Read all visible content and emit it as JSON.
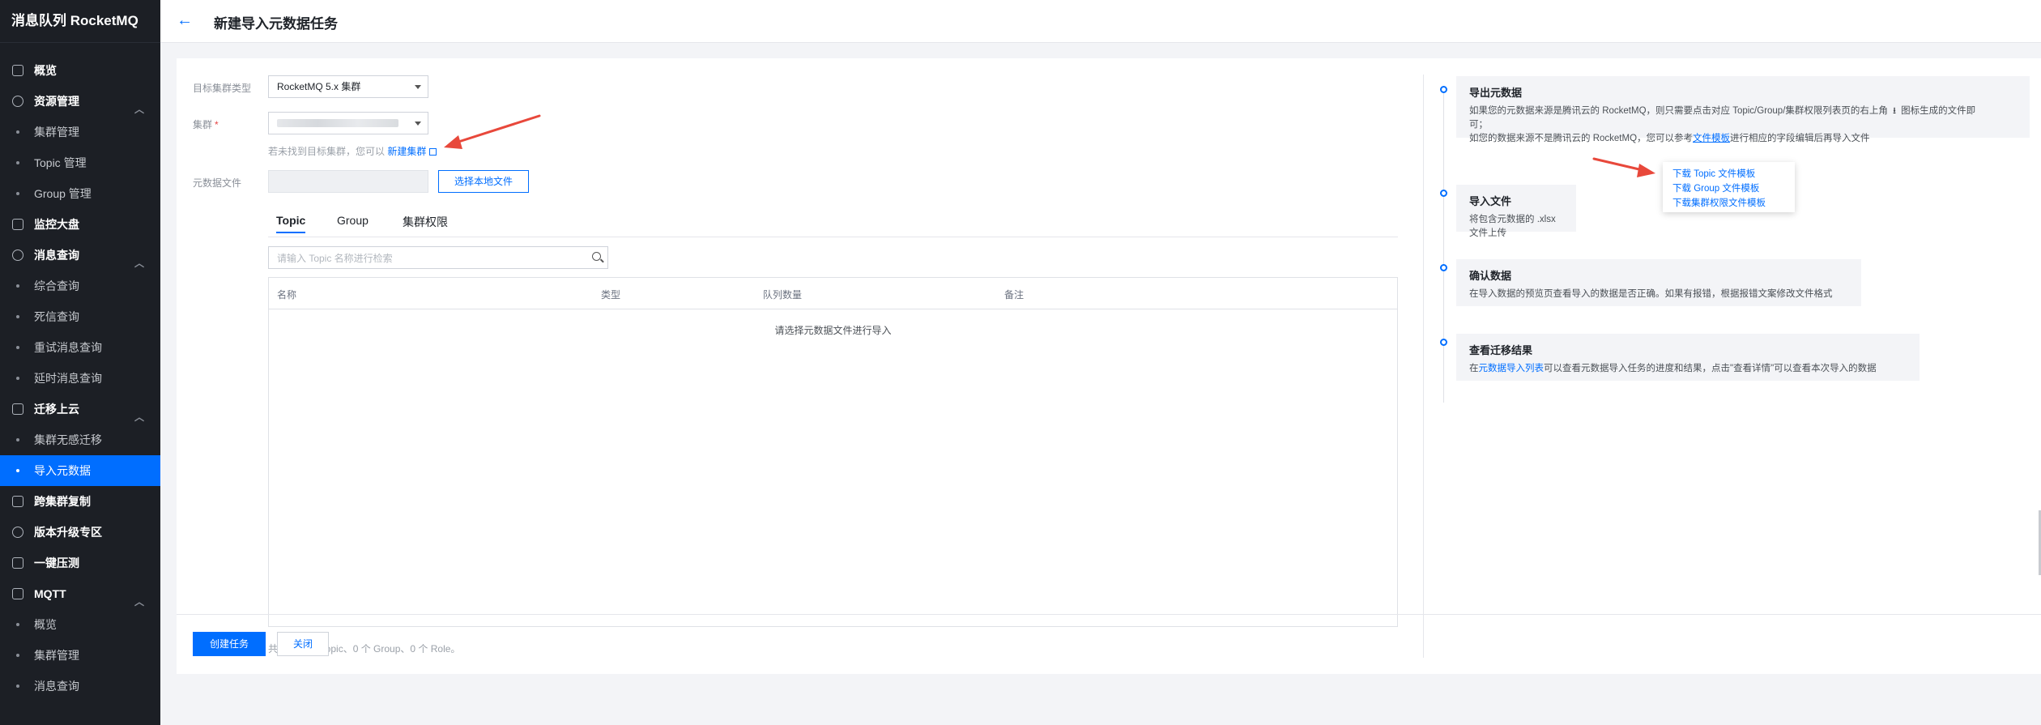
{
  "app": {
    "brand": "消息队列 RocketMQ"
  },
  "header": {
    "title": "新建导入元数据任务"
  },
  "sidebar": {
    "items": [
      {
        "label": "概览",
        "kind": "section",
        "icon": "grid-icon"
      },
      {
        "label": "资源管理",
        "kind": "section",
        "icon": "globe-icon",
        "expandable": true
      },
      {
        "label": "集群管理",
        "kind": "sub"
      },
      {
        "label": "Topic 管理",
        "kind": "sub"
      },
      {
        "label": "Group 管理",
        "kind": "sub"
      },
      {
        "label": "监控大盘",
        "kind": "section",
        "icon": "dashboard-icon"
      },
      {
        "label": "消息查询",
        "kind": "section",
        "icon": "at-icon",
        "expandable": true
      },
      {
        "label": "综合查询",
        "kind": "sub"
      },
      {
        "label": "死信查询",
        "kind": "sub"
      },
      {
        "label": "重试消息查询",
        "kind": "sub"
      },
      {
        "label": "延时消息查询",
        "kind": "sub"
      },
      {
        "label": "迁移上云",
        "kind": "section",
        "icon": "migrate-icon",
        "expandable": true
      },
      {
        "label": "集群无感迁移",
        "kind": "sub"
      },
      {
        "label": "导入元数据",
        "kind": "sub",
        "active": true
      },
      {
        "label": "跨集群复制",
        "kind": "section",
        "icon": "copy-icon"
      },
      {
        "label": "版本升级专区",
        "kind": "section",
        "icon": "shield-icon"
      },
      {
        "label": "一键压测",
        "kind": "section",
        "icon": "chart-icon"
      },
      {
        "label": "MQTT",
        "kind": "section",
        "icon": "mqtt-icon",
        "expandable": true
      },
      {
        "label": "概览",
        "kind": "sub"
      },
      {
        "label": "集群管理",
        "kind": "sub"
      },
      {
        "label": "消息查询",
        "kind": "sub"
      }
    ]
  },
  "form": {
    "cluster_type_label": "目标集群类型",
    "cluster_type_value": "RocketMQ 5.x 集群",
    "cluster_label": "集群",
    "cluster_required_mark": "*",
    "hint_prefix": "若未找到目标集群，您可以",
    "hint_link": "新建集群",
    "file_label": "元数据文件",
    "file_button": "选择本地文件"
  },
  "tabs": [
    {
      "label": "Topic",
      "active": true
    },
    {
      "label": "Group",
      "active": false
    },
    {
      "label": "集群权限",
      "active": false
    }
  ],
  "search": {
    "placeholder": "请输入 Topic 名称进行检索"
  },
  "table": {
    "columns": [
      "名称",
      "类型",
      "队列数量",
      "备注"
    ],
    "empty_text": "请选择元数据文件进行导入"
  },
  "summary": "共导入 0 个 Topic、0 个 Group、0 个 Role。",
  "steps": [
    {
      "title": "导出元数据",
      "desc_line1_a": "如果您的元数据来源是腾讯云的 RocketMQ，则只需要点击对应 Topic/Group/集群权限列表页的右上角",
      "desc_line1_b": "图标生成的文件即",
      "desc_line2": "可；",
      "desc_line3_a": "如您的数据来源不是腾讯云的 RocketMQ，您可以参考",
      "desc_line3_link": "文件模板",
      "desc_line3_b": "进行相应的字段编辑后再导入文件"
    },
    {
      "title": "导入文件",
      "desc": "将包含元数据的 .xlsx 文件上传"
    },
    {
      "title": "确认数据",
      "desc": "在导入数据的预览页查看导入的数据是否正确。如果有报错，根据报错文案修改文件格式"
    },
    {
      "title": "查看迁移结果",
      "desc_a": "在",
      "desc_link": "元数据导入列表",
      "desc_b": "可以查看元数据导入任务的进度和结果，点击\"查看详情\"可以查看本次导入的数据"
    }
  ],
  "popup": {
    "items": [
      "下载 Topic 文件模板",
      "下载 Group 文件模板",
      "下载集群权限文件模板"
    ]
  },
  "footer": {
    "create_button": "创建任务",
    "close_button": "关闭"
  },
  "colors": {
    "accent": "#006eff",
    "annotation_arrow": "#e8483b",
    "sidebar_bg": "#1c1f25"
  }
}
